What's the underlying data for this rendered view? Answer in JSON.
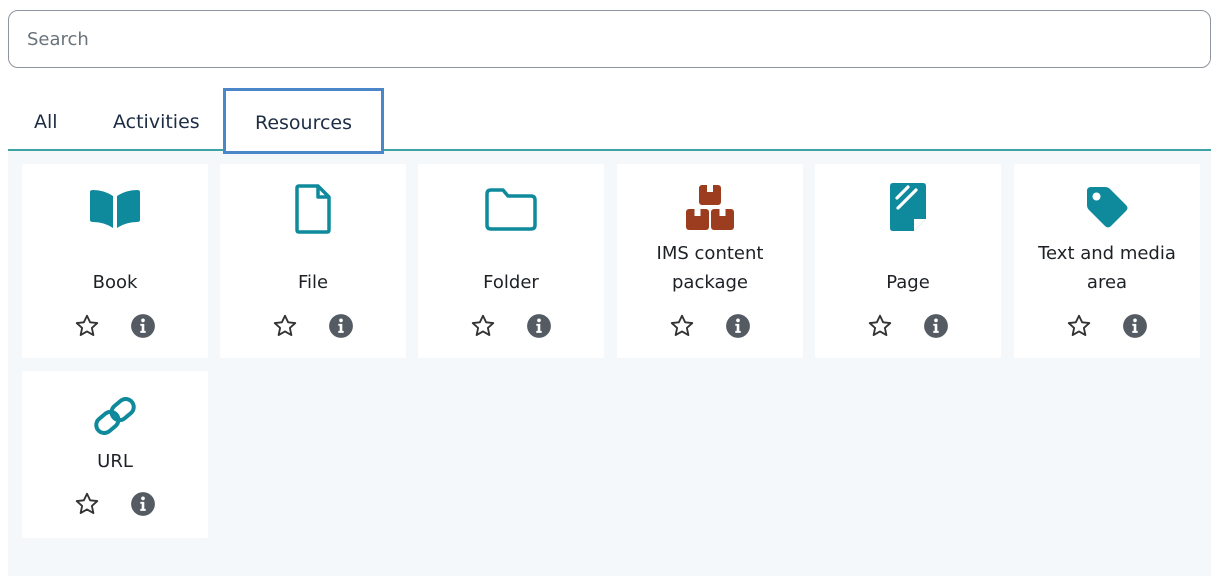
{
  "search": {
    "placeholder": "Search",
    "value": ""
  },
  "tabs": [
    {
      "label": "All"
    },
    {
      "label": "Activities"
    },
    {
      "label": "Resources",
      "active": true
    }
  ],
  "colors": {
    "accent": "#3fa3a3",
    "icon_teal": "#0f8a9c",
    "icon_brown": "#9b3d1e",
    "tab_highlight": "#4a86c8",
    "content_bg": "#f5f8fb"
  },
  "resources": [
    {
      "label": "Book",
      "icon": "book-icon"
    },
    {
      "label": "File",
      "icon": "file-icon"
    },
    {
      "label": "Folder",
      "icon": "folder-icon"
    },
    {
      "label": "IMS content package",
      "icon": "ims-package-icon"
    },
    {
      "label": "Page",
      "icon": "page-icon"
    },
    {
      "label": "Text and media area",
      "icon": "tag-icon"
    },
    {
      "label": "URL",
      "icon": "link-icon"
    }
  ]
}
